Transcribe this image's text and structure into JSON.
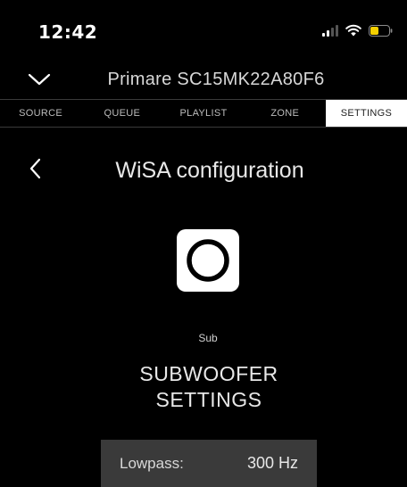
{
  "status_bar": {
    "time": "12:42",
    "icons": [
      "cellular-signal-icon",
      "wifi-icon",
      "battery-icon"
    ],
    "battery_color": "#f5d000"
  },
  "header": {
    "collapse_icon": "chevron-down-icon",
    "device_name": "Primare SC15MK22A80F6"
  },
  "tabs": [
    {
      "label": "SOURCE",
      "active": false
    },
    {
      "label": "QUEUE",
      "active": false
    },
    {
      "label": "PLAYLIST",
      "active": false
    },
    {
      "label": "ZONE",
      "active": false
    },
    {
      "label": "SETTINGS",
      "active": true
    }
  ],
  "page": {
    "back_icon": "chevron-left-icon",
    "title": "WiSA configuration",
    "speaker_icon": "subwoofer-icon",
    "speaker_label": "Sub",
    "section_title_line1": "SUBWOOFER",
    "section_title_line2": "SETTINGS"
  },
  "lowpass": {
    "label": "Lowpass:",
    "value": "300 Hz"
  }
}
